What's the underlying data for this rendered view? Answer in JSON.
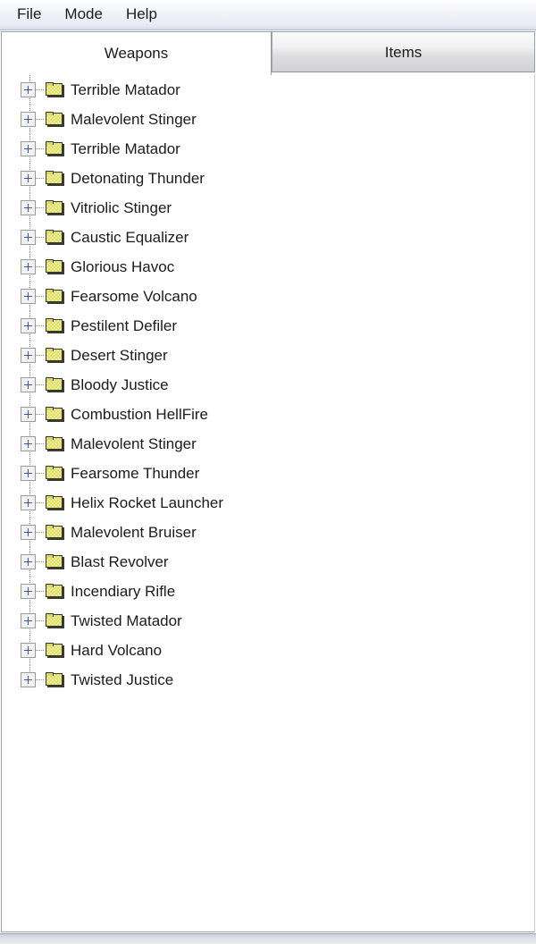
{
  "menubar": {
    "items": [
      {
        "label": "File",
        "name": "menu-file"
      },
      {
        "label": "Mode",
        "name": "menu-mode"
      },
      {
        "label": "Help",
        "name": "menu-help"
      }
    ]
  },
  "tabs": {
    "active": "Weapons",
    "items": [
      {
        "label": "Weapons",
        "active": true
      },
      {
        "label": "Items",
        "active": false
      }
    ]
  },
  "tree": {
    "expander_glyph": "+",
    "icon": "folder-icon",
    "nodes": [
      {
        "label": "Terrible Matador"
      },
      {
        "label": "Malevolent Stinger"
      },
      {
        "label": "Terrible Matador"
      },
      {
        "label": "Detonating Thunder"
      },
      {
        "label": "Vitriolic Stinger"
      },
      {
        "label": "Caustic Equalizer"
      },
      {
        "label": "Glorious Havoc"
      },
      {
        "label": "Fearsome Volcano"
      },
      {
        "label": "Pestilent Defiler"
      },
      {
        "label": "Desert Stinger"
      },
      {
        "label": "Bloody Justice"
      },
      {
        "label": "Combustion HellFire"
      },
      {
        "label": "Malevolent Stinger"
      },
      {
        "label": "Fearsome Thunder"
      },
      {
        "label": "Helix Rocket Launcher"
      },
      {
        "label": "Malevolent Bruiser"
      },
      {
        "label": "Blast Revolver"
      },
      {
        "label": "Incendiary Rifle"
      },
      {
        "label": "Twisted Matador"
      },
      {
        "label": "Hard Volcano"
      },
      {
        "label": "Twisted Justice"
      }
    ]
  },
  "colors": {
    "folder_fill": "#e3e246",
    "folder_border": "#35352c",
    "expander_plus": "#3a56b5",
    "text": "#1b1b1b",
    "tab_border": "#9aa0ae",
    "panel_background": "#ffffff"
  }
}
